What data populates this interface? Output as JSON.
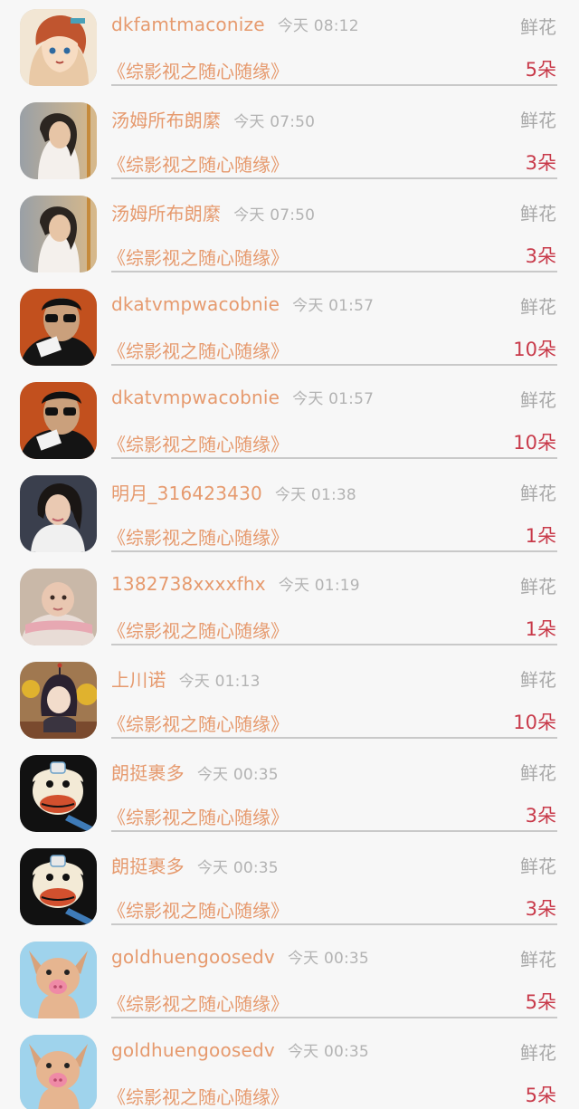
{
  "colors": {
    "background": "#f7f7f7",
    "name_text": "#e69a6e",
    "time_text": "#b3b3b3",
    "gift_type_text": "#a8a8a8",
    "count_text": "#c83a4a",
    "divider": "#c9c9c9"
  },
  "records": [
    {
      "avatar": "anime-girl-avatar",
      "name": "dkfamtmaconize",
      "time": "今天 08:12",
      "gift_type": "鲜花",
      "title": "《综影视之随心随缘》",
      "count": "5朵"
    },
    {
      "avatar": "woman-portrait-avatar",
      "name": "汤姆所布朗縻",
      "time": "今天 07:50",
      "gift_type": "鲜花",
      "title": "《综影视之随心随缘》",
      "count": "3朵"
    },
    {
      "avatar": "woman-portrait-avatar",
      "name": "汤姆所布朗縻",
      "time": "今天 07:50",
      "gift_type": "鲜花",
      "title": "《综影视之随心随缘》",
      "count": "3朵"
    },
    {
      "avatar": "man-sunglasses-avatar",
      "name": "dkatvmpwacobnie",
      "time": "今天 01:57",
      "gift_type": "鲜花",
      "title": "《综影视之随心随缘》",
      "count": "10朵"
    },
    {
      "avatar": "man-sunglasses-avatar",
      "name": "dkatvmpwacobnie",
      "time": "今天 01:57",
      "gift_type": "鲜花",
      "title": "《综影视之随心随缘》",
      "count": "10朵"
    },
    {
      "avatar": "girl-portrait-avatar",
      "name": "明月_316423430",
      "time": "今天 01:38",
      "gift_type": "鲜花",
      "title": "《综影视之随心随缘》",
      "count": "1朵"
    },
    {
      "avatar": "baby-avatar",
      "name": "1382738xxxxfhx",
      "time": "今天 01:19",
      "gift_type": "鲜花",
      "title": "《综影视之随心随缘》",
      "count": "1朵"
    },
    {
      "avatar": "anime-character-avatar",
      "name": "上川诺",
      "time": "今天 01:13",
      "gift_type": "鲜花",
      "title": "《综影视之随心随缘》",
      "count": "10朵"
    },
    {
      "avatar": "monkey-cartoon-avatar",
      "name": "朗挺裹多",
      "time": "今天 00:35",
      "gift_type": "鲜花",
      "title": "《综影视之随心随缘》",
      "count": "3朵"
    },
    {
      "avatar": "monkey-cartoon-avatar",
      "name": "朗挺裹多",
      "time": "今天 00:35",
      "gift_type": "鲜花",
      "title": "《综影视之随心随缘》",
      "count": "3朵"
    },
    {
      "avatar": "puppy-avatar",
      "name": "goldhuengoosedv",
      "time": "今天 00:35",
      "gift_type": "鲜花",
      "title": "《综影视之随心随缘》",
      "count": "5朵"
    },
    {
      "avatar": "puppy-avatar",
      "name": "goldhuengoosedv",
      "time": "今天 00:35",
      "gift_type": "鲜花",
      "title": "《综影视之随心随缘》",
      "count": "5朵"
    }
  ]
}
